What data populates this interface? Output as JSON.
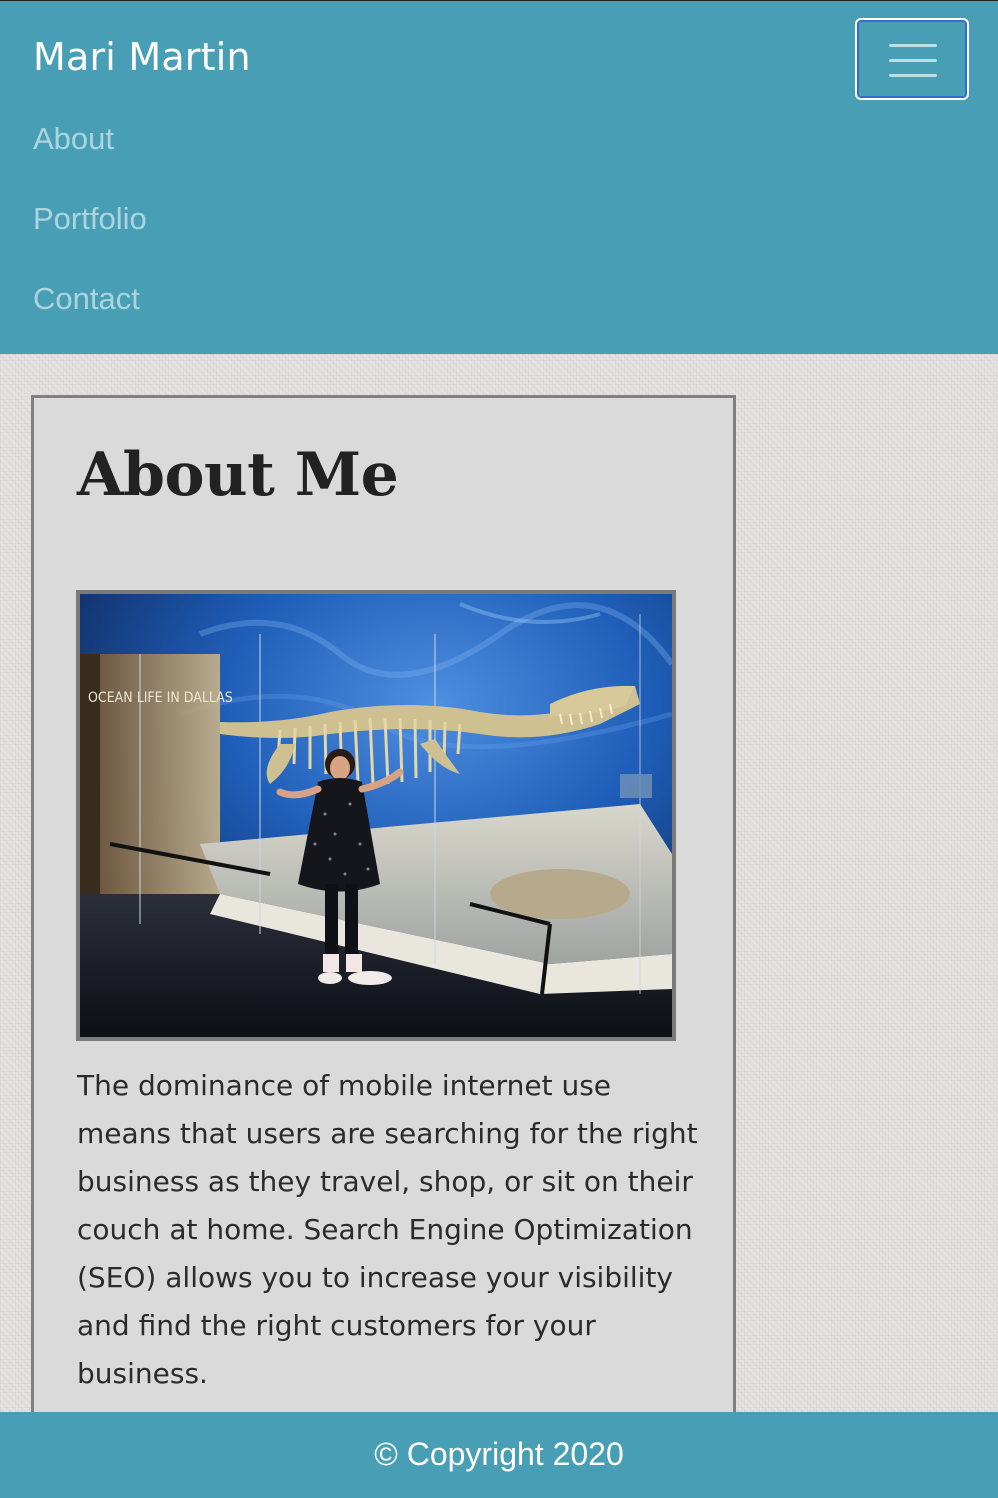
{
  "navbar": {
    "brand": "Mari Martin",
    "toggle_icon": "hamburger-icon",
    "links": [
      {
        "label": "About"
      },
      {
        "label": "Portfolio"
      },
      {
        "label": "Contact"
      }
    ]
  },
  "about": {
    "heading": "About Me",
    "photo": {
      "sign_text": "OCEAN LIFE IN DALLAS"
    },
    "bio": "The dominance of mobile internet use means that users are searching for the right business as they travel, shop, or sit on their couch at home. Search Engine Optimization (SEO) allows you to increase your visibility and find the right customers for your business."
  },
  "footer": {
    "copyright": "© Copyright 2020"
  },
  "colors": {
    "navbar_bg": "#489fb5",
    "card_bg": "#dadada",
    "card_border": "#808080",
    "text_dark": "#222222"
  }
}
